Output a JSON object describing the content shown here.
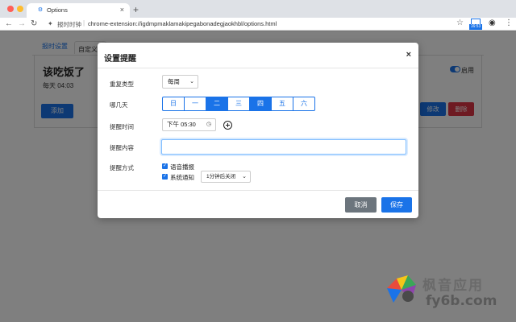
{
  "browser": {
    "tab_title": "Options",
    "tab_close": "×",
    "new_tab": "+",
    "site_name": "报时时钟",
    "url": "chrome-extension://igdmpmaklamakipegabonadegjaokhbl/options.html",
    "extension_badge": "16:53"
  },
  "page": {
    "tabs": [
      "报时设置",
      "自定义"
    ],
    "card": {
      "title": "该吃饭了",
      "schedule": "每天 04:03",
      "toggle_label": "启用",
      "toggle_on": true,
      "edit_label": "修改",
      "delete_label": "删除"
    },
    "add_label": "添加"
  },
  "modal": {
    "title": "设置提醒",
    "close": "×",
    "repeat_label": "重复类型",
    "repeat_value": "每周",
    "days_label": "哪几天",
    "days": [
      {
        "label": "日",
        "active": false
      },
      {
        "label": "一",
        "active": false
      },
      {
        "label": "二",
        "active": true
      },
      {
        "label": "三",
        "active": false
      },
      {
        "label": "四",
        "active": true
      },
      {
        "label": "五",
        "active": false
      },
      {
        "label": "六",
        "active": false
      }
    ],
    "time_label": "提醒时间",
    "time_value": "下午 05:30",
    "content_label": "提醒内容",
    "content_value": "",
    "method_label": "提醒方式",
    "voice_label": "语音播报",
    "voice_checked": true,
    "notify_label": "系统通知",
    "notify_checked": true,
    "notify_close_option": "1分钟后关闭",
    "cancel_label": "取消",
    "save_label": "保存"
  },
  "watermark": {
    "text_top": "枫音应用",
    "text_bottom": "fy6b.com"
  },
  "colors": {
    "accent": "#1a73e8",
    "danger": "#dc3545",
    "secondary": "#6c757d"
  }
}
